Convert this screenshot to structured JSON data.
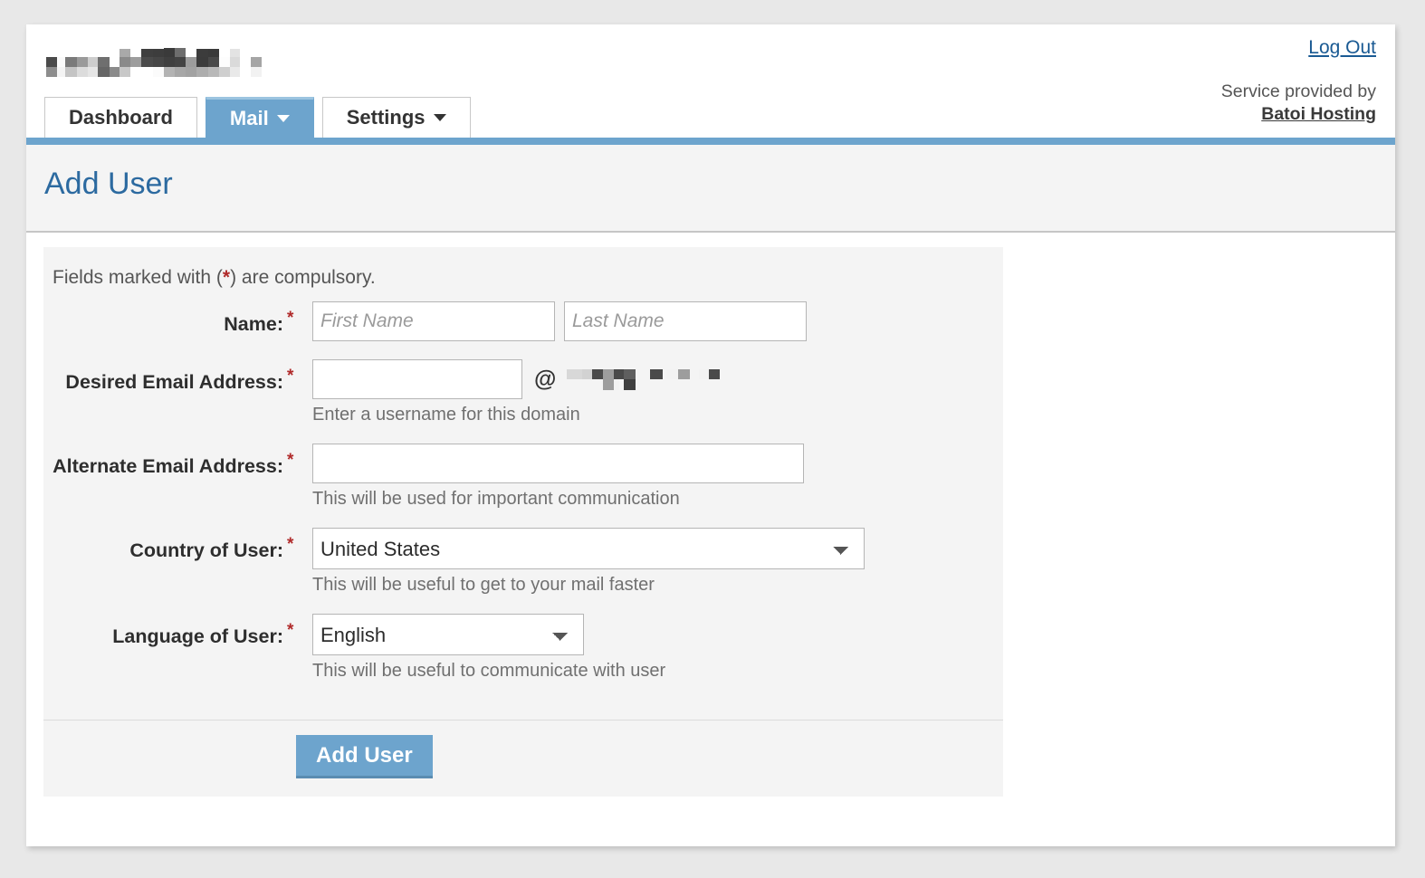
{
  "header": {
    "brand_logo": "redacted-company-logo",
    "logout_label": "Log Out",
    "service_prefix": "Service provided by",
    "service_provider": "Batoi Hosting",
    "accent_color": "#6da4cd"
  },
  "tabs": [
    {
      "label": "Dashboard",
      "active": false,
      "has_caret": false
    },
    {
      "label": "Mail",
      "active": true,
      "has_caret": true
    },
    {
      "label": "Settings",
      "active": false,
      "has_caret": true
    }
  ],
  "page": {
    "title": "Add User",
    "title_color": "#2c6aa0"
  },
  "form": {
    "compulsory_note_prefix": "Fields marked with (",
    "compulsory_note_star": "*",
    "compulsory_note_suffix": ") are compulsory.",
    "required_marker": "*",
    "required_color": "#b02a2a",
    "rows": {
      "name": {
        "label": "Name:",
        "first_placeholder": "First Name",
        "first_value": "",
        "last_placeholder": "Last Name",
        "last_value": ""
      },
      "desired_email": {
        "label": "Desired Email Address:",
        "value": "",
        "placeholder": "",
        "at_symbol": "@",
        "domain": "redacted-domain",
        "hint": "Enter a username for this domain"
      },
      "alternate_email": {
        "label": "Alternate Email Address:",
        "value": "",
        "placeholder": "",
        "hint": "This will be used for important communication"
      },
      "country": {
        "label": "Country of User:",
        "selected": "United States",
        "options": [
          "United States"
        ],
        "hint": "This will be useful to get to your mail faster"
      },
      "language": {
        "label": "Language of User:",
        "selected": "English",
        "options": [
          "English"
        ],
        "hint": "This will be useful to communicate with user"
      }
    },
    "submit_label": "Add User"
  }
}
